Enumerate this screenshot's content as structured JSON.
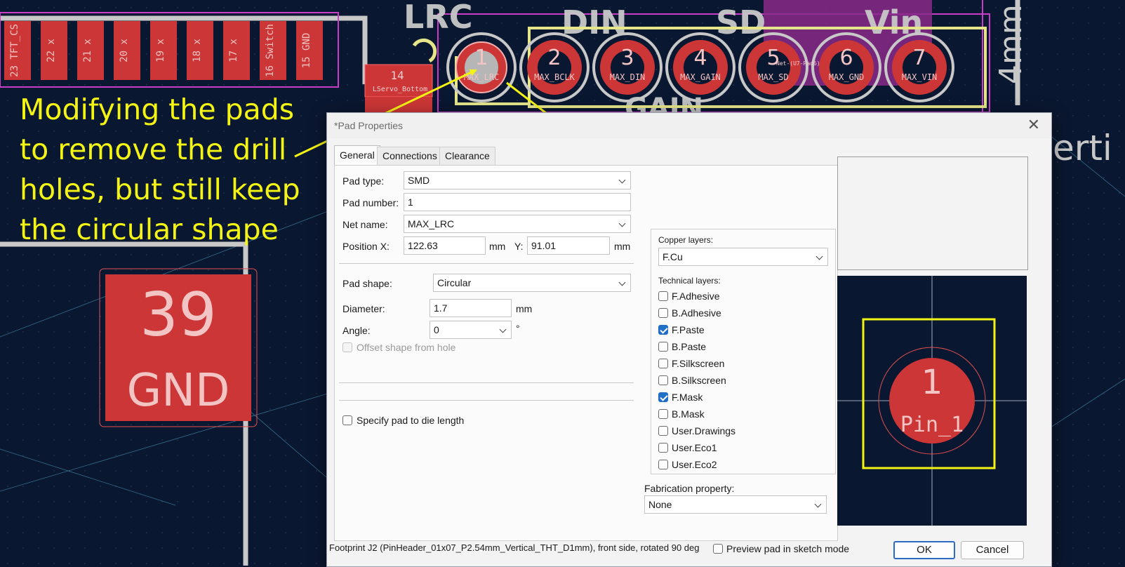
{
  "annotation": {
    "text_lines": [
      "Modifying the pads",
      "to remove the drill",
      "holes, but still keep",
      "the circular shape"
    ],
    "color": "#f3f314"
  },
  "pcb": {
    "left_pads": [
      "23 TFT_CS",
      "22 x",
      "21 x",
      "20 x",
      "19 x",
      "18 x",
      "17 x",
      "16 Switch",
      "15 GND"
    ],
    "header_pins": [
      {
        "num": "1",
        "net": "MAX_LRC"
      },
      {
        "num": "2",
        "net": "MAX_BCLK"
      },
      {
        "num": "3",
        "net": "MAX_DIN"
      },
      {
        "num": "4",
        "net": "MAX_GAIN"
      },
      {
        "num": "5",
        "net": "MAX_SD"
      },
      {
        "num": "6",
        "net": "MAX_GND"
      },
      {
        "num": "7",
        "net": "MAX_VIN"
      }
    ],
    "silk_labels": [
      "LRC",
      "DIN",
      "SD",
      "Vin",
      "GAIN",
      "4mm",
      "erti"
    ],
    "small_pad": {
      "num": "14",
      "net": "LServo_Bottom"
    },
    "pad5_net_partial": "Net-(U7-Pad6)",
    "big_pad": {
      "num": "39",
      "net": "GND"
    },
    "colors": {
      "board": "#0a1730",
      "pad": "#cc3636",
      "silk": "#c8c8c8",
      "courtyard": "#e5e58a",
      "magenta": "#c93ec9"
    }
  },
  "dialog": {
    "title": "*Pad Properties",
    "close_icon": "close-icon",
    "tabs": [
      "General",
      "Connections",
      "Clearance Overrides"
    ],
    "fields": {
      "pad_type_label": "Pad type:",
      "pad_type_value": "SMD",
      "pad_number_label": "Pad number:",
      "pad_number_value": "1",
      "net_name_label": "Net name:",
      "net_name_value": "MAX_LRC",
      "position_x_label": "Position X:",
      "position_x_value": "122.63",
      "position_y_label": "Y:",
      "position_y_value": "91.01",
      "unit": "mm",
      "pad_shape_label": "Pad shape:",
      "pad_shape_value": "Circular",
      "diameter_label": "Diameter:",
      "diameter_value": "1.7",
      "angle_label": "Angle:",
      "angle_value": "0",
      "angle_unit": "°",
      "offset_shape_label": "Offset shape from hole",
      "pad_to_die_label": "Specify pad to die length"
    },
    "copper_layers_label": "Copper layers:",
    "copper_layers_value": "F.Cu",
    "technical_layers_label": "Technical layers:",
    "technical_layers": [
      {
        "name": "F.Adhesive",
        "checked": false
      },
      {
        "name": "B.Adhesive",
        "checked": false
      },
      {
        "name": "F.Paste",
        "checked": true
      },
      {
        "name": "B.Paste",
        "checked": false
      },
      {
        "name": "F.Silkscreen",
        "checked": false
      },
      {
        "name": "B.Silkscreen",
        "checked": false
      },
      {
        "name": "F.Mask",
        "checked": true
      },
      {
        "name": "B.Mask",
        "checked": false
      },
      {
        "name": "User.Drawings",
        "checked": false
      },
      {
        "name": "User.Eco1",
        "checked": false
      },
      {
        "name": "User.Eco2",
        "checked": false
      }
    ],
    "fabrication_label": "Fabrication property:",
    "fabrication_value": "None",
    "preview": {
      "pad_number": "1",
      "pad_name": "Pin_1"
    },
    "footer_status": "Footprint J2 (PinHeader_01x07_P2.54mm_Vertical_THT_D1mm), front side, rotated 90 deg",
    "preview_sketch_label": "Preview pad in sketch mode",
    "ok_label": "OK",
    "cancel_label": "Cancel",
    "accent": "#1f6fc9"
  }
}
